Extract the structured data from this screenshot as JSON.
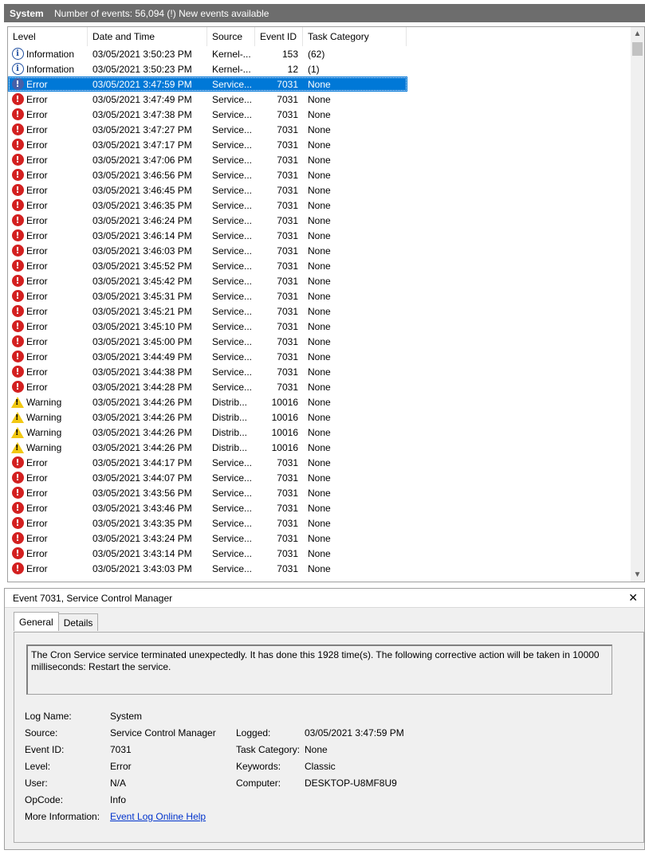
{
  "title": {
    "name": "System",
    "info": "Number of events: 56,094 (!) New events available"
  },
  "columns": {
    "level": "Level",
    "date": "Date and Time",
    "source": "Source",
    "event_id": "Event ID",
    "task": "Task Category"
  },
  "rows": [
    {
      "type": "info",
      "level": "Information",
      "date": "03/05/2021 3:50:23 PM",
      "source": "Kernel-...",
      "id": "153",
      "task": "(62)"
    },
    {
      "type": "info",
      "level": "Information",
      "date": "03/05/2021 3:50:23 PM",
      "source": "Kernel-...",
      "id": "12",
      "task": "(1)"
    },
    {
      "type": "error",
      "level": "Error",
      "date": "03/05/2021 3:47:59 PM",
      "source": "Service...",
      "id": "7031",
      "task": "None",
      "selected": true
    },
    {
      "type": "error",
      "level": "Error",
      "date": "03/05/2021 3:47:49 PM",
      "source": "Service...",
      "id": "7031",
      "task": "None"
    },
    {
      "type": "error",
      "level": "Error",
      "date": "03/05/2021 3:47:38 PM",
      "source": "Service...",
      "id": "7031",
      "task": "None"
    },
    {
      "type": "error",
      "level": "Error",
      "date": "03/05/2021 3:47:27 PM",
      "source": "Service...",
      "id": "7031",
      "task": "None"
    },
    {
      "type": "error",
      "level": "Error",
      "date": "03/05/2021 3:47:17 PM",
      "source": "Service...",
      "id": "7031",
      "task": "None"
    },
    {
      "type": "error",
      "level": "Error",
      "date": "03/05/2021 3:47:06 PM",
      "source": "Service...",
      "id": "7031",
      "task": "None"
    },
    {
      "type": "error",
      "level": "Error",
      "date": "03/05/2021 3:46:56 PM",
      "source": "Service...",
      "id": "7031",
      "task": "None"
    },
    {
      "type": "error",
      "level": "Error",
      "date": "03/05/2021 3:46:45 PM",
      "source": "Service...",
      "id": "7031",
      "task": "None"
    },
    {
      "type": "error",
      "level": "Error",
      "date": "03/05/2021 3:46:35 PM",
      "source": "Service...",
      "id": "7031",
      "task": "None"
    },
    {
      "type": "error",
      "level": "Error",
      "date": "03/05/2021 3:46:24 PM",
      "source": "Service...",
      "id": "7031",
      "task": "None"
    },
    {
      "type": "error",
      "level": "Error",
      "date": "03/05/2021 3:46:14 PM",
      "source": "Service...",
      "id": "7031",
      "task": "None"
    },
    {
      "type": "error",
      "level": "Error",
      "date": "03/05/2021 3:46:03 PM",
      "source": "Service...",
      "id": "7031",
      "task": "None"
    },
    {
      "type": "error",
      "level": "Error",
      "date": "03/05/2021 3:45:52 PM",
      "source": "Service...",
      "id": "7031",
      "task": "None"
    },
    {
      "type": "error",
      "level": "Error",
      "date": "03/05/2021 3:45:42 PM",
      "source": "Service...",
      "id": "7031",
      "task": "None"
    },
    {
      "type": "error",
      "level": "Error",
      "date": "03/05/2021 3:45:31 PM",
      "source": "Service...",
      "id": "7031",
      "task": "None"
    },
    {
      "type": "error",
      "level": "Error",
      "date": "03/05/2021 3:45:21 PM",
      "source": "Service...",
      "id": "7031",
      "task": "None"
    },
    {
      "type": "error",
      "level": "Error",
      "date": "03/05/2021 3:45:10 PM",
      "source": "Service...",
      "id": "7031",
      "task": "None"
    },
    {
      "type": "error",
      "level": "Error",
      "date": "03/05/2021 3:45:00 PM",
      "source": "Service...",
      "id": "7031",
      "task": "None"
    },
    {
      "type": "error",
      "level": "Error",
      "date": "03/05/2021 3:44:49 PM",
      "source": "Service...",
      "id": "7031",
      "task": "None"
    },
    {
      "type": "error",
      "level": "Error",
      "date": "03/05/2021 3:44:38 PM",
      "source": "Service...",
      "id": "7031",
      "task": "None"
    },
    {
      "type": "error",
      "level": "Error",
      "date": "03/05/2021 3:44:28 PM",
      "source": "Service...",
      "id": "7031",
      "task": "None"
    },
    {
      "type": "warning",
      "level": "Warning",
      "date": "03/05/2021 3:44:26 PM",
      "source": "Distrib...",
      "id": "10016",
      "task": "None"
    },
    {
      "type": "warning",
      "level": "Warning",
      "date": "03/05/2021 3:44:26 PM",
      "source": "Distrib...",
      "id": "10016",
      "task": "None"
    },
    {
      "type": "warning",
      "level": "Warning",
      "date": "03/05/2021 3:44:26 PM",
      "source": "Distrib...",
      "id": "10016",
      "task": "None"
    },
    {
      "type": "warning",
      "level": "Warning",
      "date": "03/05/2021 3:44:26 PM",
      "source": "Distrib...",
      "id": "10016",
      "task": "None"
    },
    {
      "type": "error",
      "level": "Error",
      "date": "03/05/2021 3:44:17 PM",
      "source": "Service...",
      "id": "7031",
      "task": "None"
    },
    {
      "type": "error",
      "level": "Error",
      "date": "03/05/2021 3:44:07 PM",
      "source": "Service...",
      "id": "7031",
      "task": "None"
    },
    {
      "type": "error",
      "level": "Error",
      "date": "03/05/2021 3:43:56 PM",
      "source": "Service...",
      "id": "7031",
      "task": "None"
    },
    {
      "type": "error",
      "level": "Error",
      "date": "03/05/2021 3:43:46 PM",
      "source": "Service...",
      "id": "7031",
      "task": "None"
    },
    {
      "type": "error",
      "level": "Error",
      "date": "03/05/2021 3:43:35 PM",
      "source": "Service...",
      "id": "7031",
      "task": "None"
    },
    {
      "type": "error",
      "level": "Error",
      "date": "03/05/2021 3:43:24 PM",
      "source": "Service...",
      "id": "7031",
      "task": "None"
    },
    {
      "type": "error",
      "level": "Error",
      "date": "03/05/2021 3:43:14 PM",
      "source": "Service...",
      "id": "7031",
      "task": "None"
    },
    {
      "type": "error",
      "level": "Error",
      "date": "03/05/2021 3:43:03 PM",
      "source": "Service...",
      "id": "7031",
      "task": "None"
    }
  ],
  "details": {
    "header": "Event 7031, Service Control Manager",
    "close_glyph": "✕",
    "tabs": [
      "General",
      "Details"
    ],
    "description": "The Cron Service service terminated unexpectedly.  It has done this 1928 time(s).  The following corrective action will be taken in 10000 milliseconds: Restart the service.",
    "log_name_label": "Log Name:",
    "log_name": "System",
    "source_label": "Source:",
    "source": "Service Control Manager",
    "logged_label": "Logged:",
    "logged": "03/05/2021 3:47:59 PM",
    "event_id_label": "Event ID:",
    "event_id": "7031",
    "task_label": "Task Category:",
    "task": "None",
    "level_label": "Level:",
    "level": "Error",
    "keywords_label": "Keywords:",
    "keywords": "Classic",
    "user_label": "User:",
    "user": "N/A",
    "computer_label": "Computer:",
    "computer": "DESKTOP-U8MF8U9",
    "opcode_label": "OpCode:",
    "opcode": "Info",
    "more_info_label": "More Information:",
    "more_info_link": "Event Log Online Help"
  },
  "icons": {
    "error": "error-icon",
    "info": "information-icon",
    "warning": "warning-icon",
    "scroll_up": "scroll-up-icon",
    "scroll_down": "scroll-down-icon",
    "close": "close-icon"
  }
}
